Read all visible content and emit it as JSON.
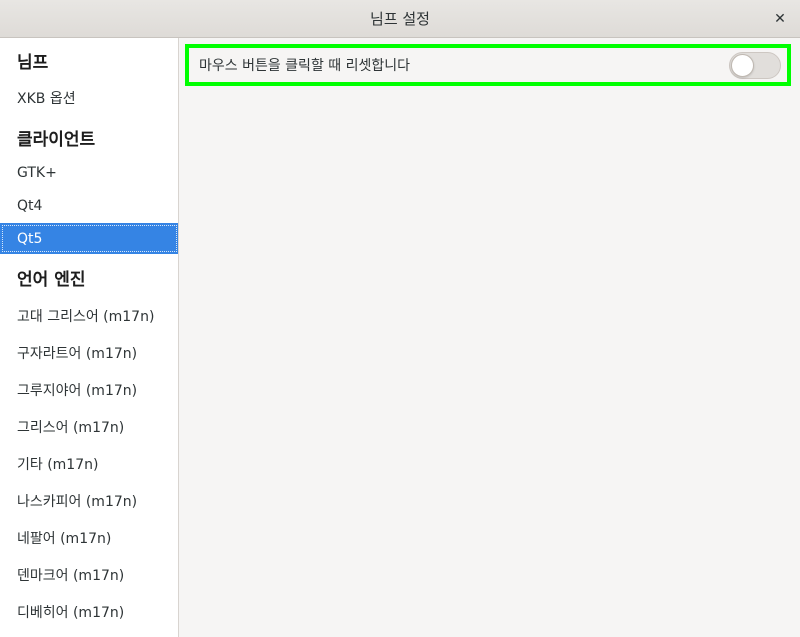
{
  "window": {
    "title": "님프 설정",
    "close_glyph": "✕"
  },
  "sidebar": {
    "sections": [
      {
        "header": "님프",
        "items": [
          "XKB 옵션"
        ]
      },
      {
        "header": "클라이언트",
        "items": [
          "GTK+",
          "Qt4",
          "Qt5"
        ]
      },
      {
        "header": "언어 엔진",
        "items": [
          "고대 그리스어 (m17n)",
          "구자라트어 (m17n)",
          "그루지야어 (m17n)",
          "그리스어 (m17n)",
          "기타 (m17n)",
          "나스카피어 (m17n)",
          "네팔어 (m17n)",
          "덴마크어 (m17n)",
          "디베히어 (m17n)"
        ]
      }
    ],
    "selected": "Qt5"
  },
  "content": {
    "setting_label": "마우스 버튼을 클릭할 때 리셋합니다",
    "toggle_on": false,
    "highlight_color": "#00ff00"
  },
  "accent_color": "#3584e4"
}
